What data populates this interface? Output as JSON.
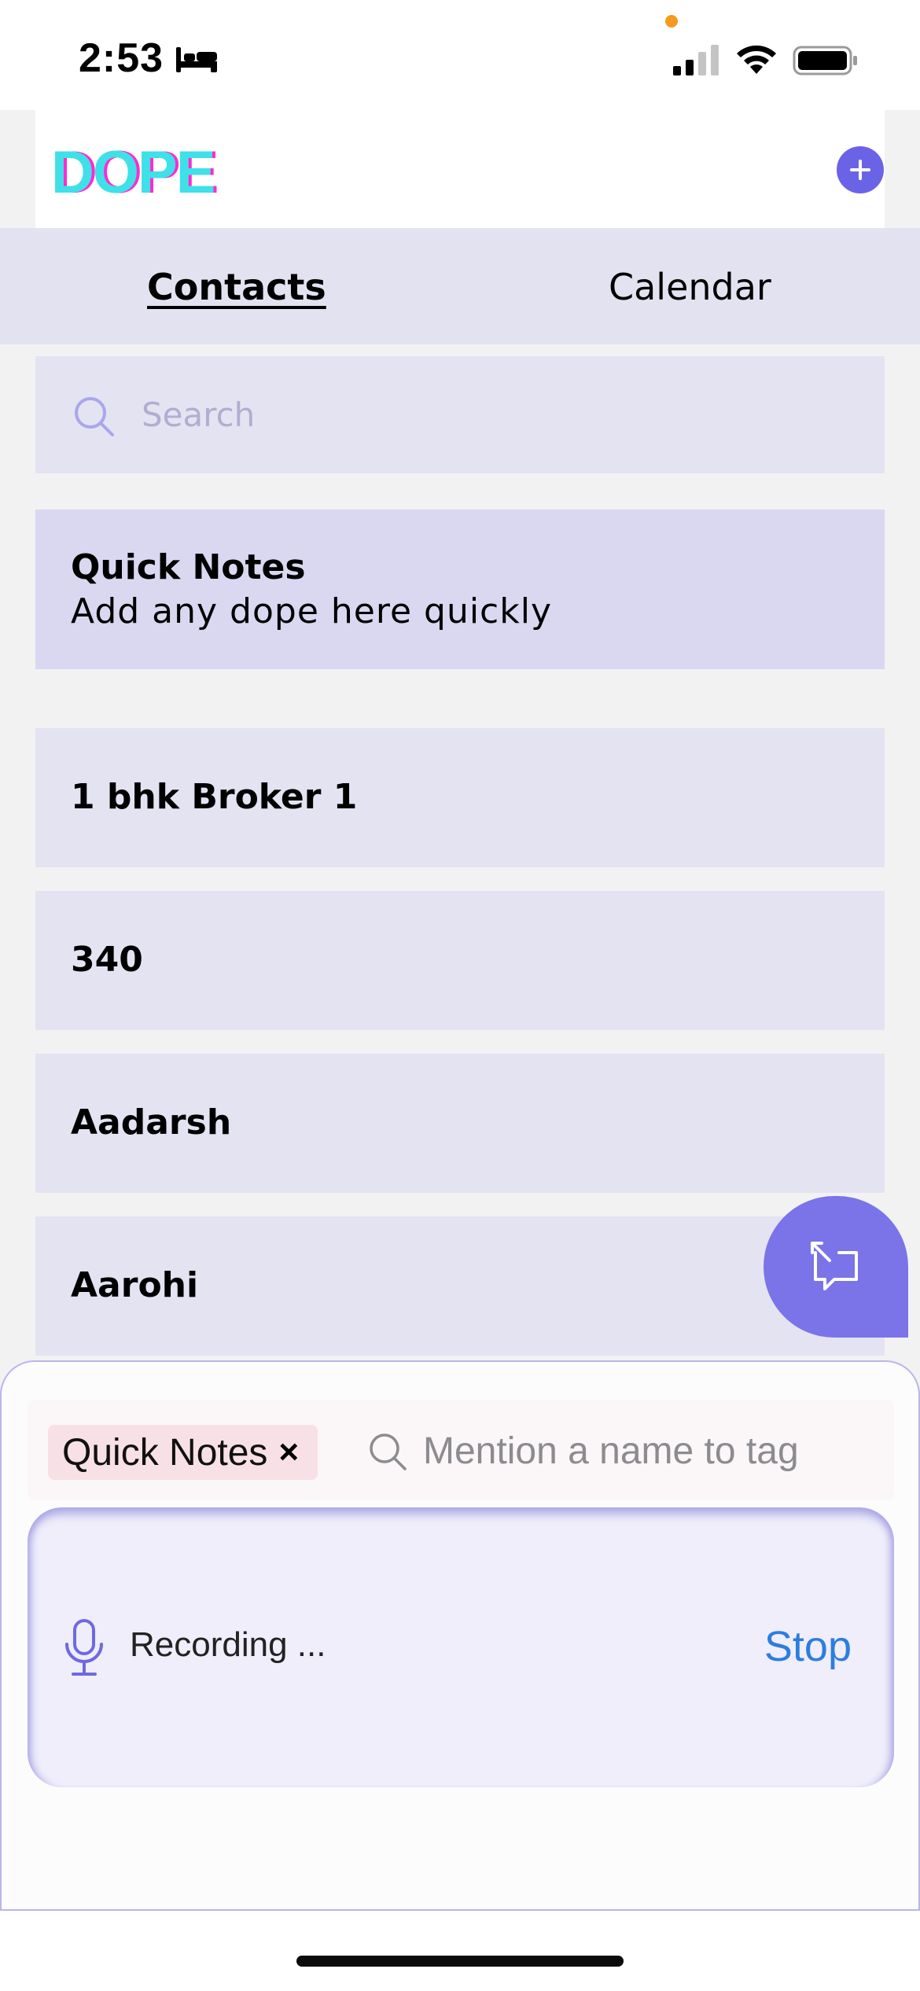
{
  "status_bar": {
    "time": "2:53",
    "icons": [
      "bed-icon",
      "signal-icon",
      "wifi-icon",
      "battery-icon"
    ]
  },
  "header": {
    "logo_text": "DOPE",
    "add_icon": "plus-icon"
  },
  "tabs": [
    {
      "label": "Contacts",
      "active": true
    },
    {
      "label": "Calendar",
      "active": false
    }
  ],
  "search": {
    "placeholder": "Search",
    "icon": "search-icon"
  },
  "quick_notes": {
    "title": "Quick Notes",
    "subtitle": "Add any dope here quickly"
  },
  "contacts": [
    {
      "name": "1 bhk Broker 1"
    },
    {
      "name": "340"
    },
    {
      "name": "Aadarsh"
    },
    {
      "name": "Aarohi"
    }
  ],
  "fab": {
    "icon": "chat-expand-icon"
  },
  "sheet": {
    "tag_chip_label": "Quick Notes",
    "tag_chip_close": "×",
    "mention_placeholder": "Mention a name to tag",
    "recording_text": "Recording ...",
    "stop_label": "Stop"
  },
  "colors": {
    "accent": "#6b63e6",
    "tab_bar": "#e3e2f1",
    "card": "#e4e3f2",
    "quick_notes": "#d9d8f0",
    "stop_link": "#2d7de0",
    "logo_cyan": "#3fe0e8",
    "logo_magenta": "#ff2bd0"
  }
}
